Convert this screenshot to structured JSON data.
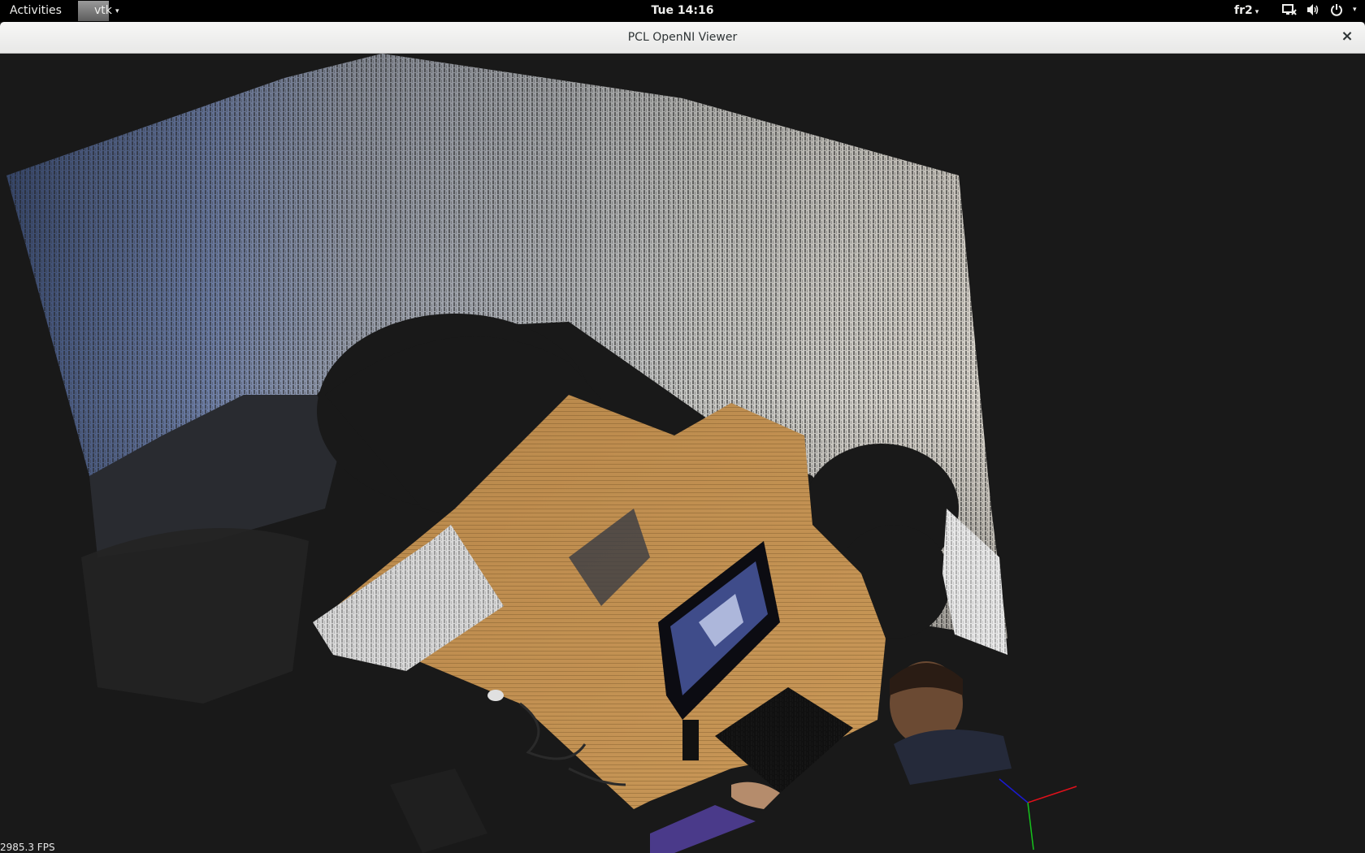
{
  "topbar": {
    "activities": "Activities",
    "app_name": "vtk",
    "clock": "Tue 14:16",
    "keyboard_layout": "fr2"
  },
  "window": {
    "title": "PCL OpenNI Viewer",
    "close_symbol": "×"
  },
  "viewer": {
    "fps_text": "2985.3 FPS",
    "axes_colors": {
      "x": "#e0101a",
      "y": "#16c21c",
      "z": "#1a1ad0"
    },
    "background": "#191919"
  },
  "icons": {
    "network": "network-icon",
    "volume": "volume-icon",
    "power": "power-icon",
    "window_close": "close-icon"
  }
}
